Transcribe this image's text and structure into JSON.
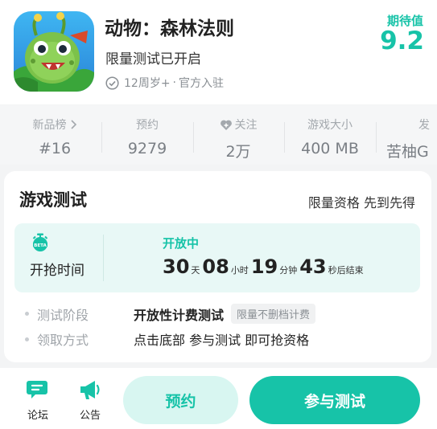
{
  "app": {
    "name": "动物：森林法则",
    "tagline": "限量测试已开启",
    "age_rating": "12周岁+",
    "separator": "·",
    "official": "官方入驻",
    "rating_label": "期待值",
    "rating_value": "9.2"
  },
  "stats": [
    {
      "label": "新品榜",
      "value": "#16"
    },
    {
      "label": "预约",
      "value": "9279"
    },
    {
      "label": "关注",
      "value": "2万"
    },
    {
      "label": "游戏大小",
      "value": "400 MB"
    },
    {
      "label": "发",
      "value": "苦柚G"
    }
  ],
  "test_card": {
    "title": "游戏测试",
    "note": "限量资格 先到先得",
    "grab_label": "开抢时间",
    "status": "开放中",
    "countdown": {
      "days": "30",
      "days_unit": "天",
      "hours": "08",
      "hours_unit": "小时",
      "minutes": "19",
      "minutes_unit": "分钟",
      "seconds": "43",
      "seconds_unit": "秒后结束"
    },
    "rows": [
      {
        "key": "测试阶段",
        "value": "开放性计费测试",
        "tag": "限量不删档计费"
      },
      {
        "key": "领取方式",
        "value": "点击底部 参与测试 即可抢资格"
      }
    ]
  },
  "bottom_bar": {
    "forum_label": "论坛",
    "notice_label": "公告",
    "reserve_label": "预约",
    "join_label": "参与测试"
  },
  "colors": {
    "accent": "#17c3a8",
    "accent_light": "#d8f6f1",
    "box_bg": "#e8f8f6"
  }
}
